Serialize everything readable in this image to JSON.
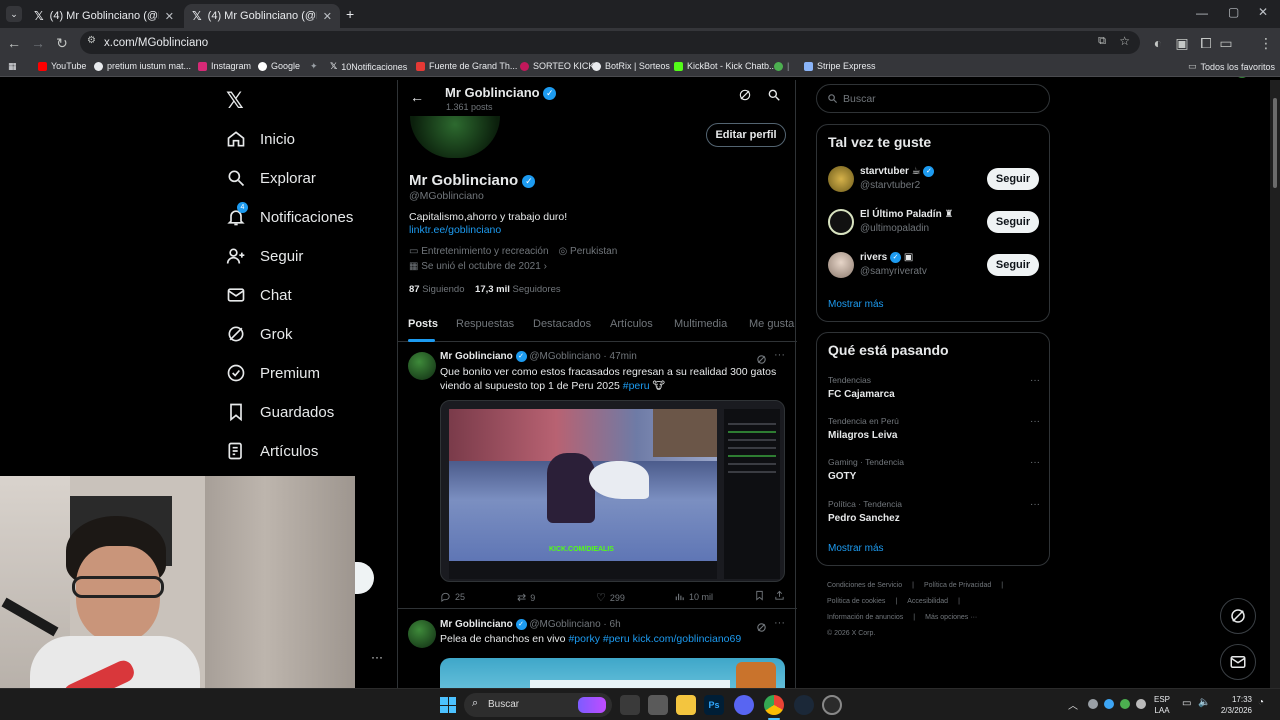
{
  "browser": {
    "tabs": [
      {
        "label": "(4) Mr Goblinciano (@MGoblinc",
        "active": false
      },
      {
        "label": "(4) Mr Goblinciano (@MGoblinc",
        "active": true
      }
    ],
    "url": "x.com/MGoblinciano",
    "bookmarks": [
      "YouTube",
      "pretium iustum mat...",
      "Instagram",
      "Google",
      "10Notificaciones",
      "Fuente de Grand Th...",
      "SORTEO KICK",
      "BotRix | Sorteos",
      "KickBot - Kick Chatb...",
      "Stripe Express"
    ],
    "bookmarks_all": "Todos los favoritos"
  },
  "nav": {
    "items": [
      "Inicio",
      "Explorar",
      "Notificaciones",
      "Seguir",
      "Chat",
      "Grok",
      "Premium",
      "Guardados",
      "Artículos"
    ],
    "notif_badge": "4"
  },
  "profile": {
    "header_name": "Mr Goblinciano",
    "header_posts": "1.361 posts",
    "name": "Mr Goblinciano",
    "handle": "@MGoblinciano",
    "edit_button": "Editar perfil",
    "bio": "Capitalismo,ahorro y trabajo duro!",
    "link": "linktr.ee/goblinciano",
    "category": "Entretenimiento y recreación",
    "location": "Perukistan",
    "joined": "Se unió el octubre de 2021",
    "following_count": "87",
    "following_label": "Siguiendo",
    "followers_count": "17,3 mil",
    "followers_label": "Seguidores",
    "tabs": [
      "Posts",
      "Respuestas",
      "Destacados",
      "Artículos",
      "Multimedia",
      "Me gusta"
    ]
  },
  "posts": [
    {
      "name": "Mr Goblinciano",
      "handle": "@MGoblinciano",
      "time": "· 47min",
      "text": "Que bonito ver como estos fracasados regresan a su realidad 300 gatos viendo al supuesto top 1 de Peru 2025",
      "hashtag": "#peru",
      "media_caption": "KICK.COM/DIEALIS",
      "replies": "25",
      "reposts": "9",
      "likes": "299",
      "views": "10 mil"
    },
    {
      "name": "Mr Goblinciano",
      "handle": "@MGoblinciano",
      "time": "· 6h",
      "text": "Pelea de chanchos en vivo",
      "links": "#porky #peru kick.com/goblinciano69"
    }
  ],
  "right": {
    "search_placeholder": "Buscar",
    "suggest_title": "Tal vez te guste",
    "suggestions": [
      {
        "name": "starvtuber",
        "handle": "@starvtuber2",
        "button": "Seguir"
      },
      {
        "name": "El Último Paladín",
        "handle": "@ultimopaladin",
        "button": "Seguir"
      },
      {
        "name": "rivers",
        "handle": "@samyriveratv",
        "button": "Seguir"
      }
    ],
    "show_more": "Mostrar más",
    "trends_title": "Qué está pasando",
    "trends": [
      {
        "category": "Tendencias",
        "name": "FC Cajamarca"
      },
      {
        "category": "Tendencia en Perú",
        "name": "Milagros Leiva"
      },
      {
        "category": "Gaming · Tendencia",
        "name": "GOTY"
      },
      {
        "category": "Política · Tendencia",
        "name": "Pedro Sanchez"
      }
    ],
    "trends_more": "Mostrar más",
    "footer": [
      "Condiciones de Servicio",
      "Política de Privacidad",
      "Política de cookies",
      "Accesibilidad",
      "Información de anuncios",
      "Más opciones ···",
      "© 2026 X Corp."
    ]
  },
  "taskbar": {
    "search": "Buscar",
    "lang": "ESP",
    "lang2": "LAA",
    "time": "17:33",
    "date": "2/3/2026"
  },
  "colors": {
    "accent": "#1d9bf0",
    "bg": "#000000",
    "border": "#2f3336",
    "muted": "#71767b"
  }
}
